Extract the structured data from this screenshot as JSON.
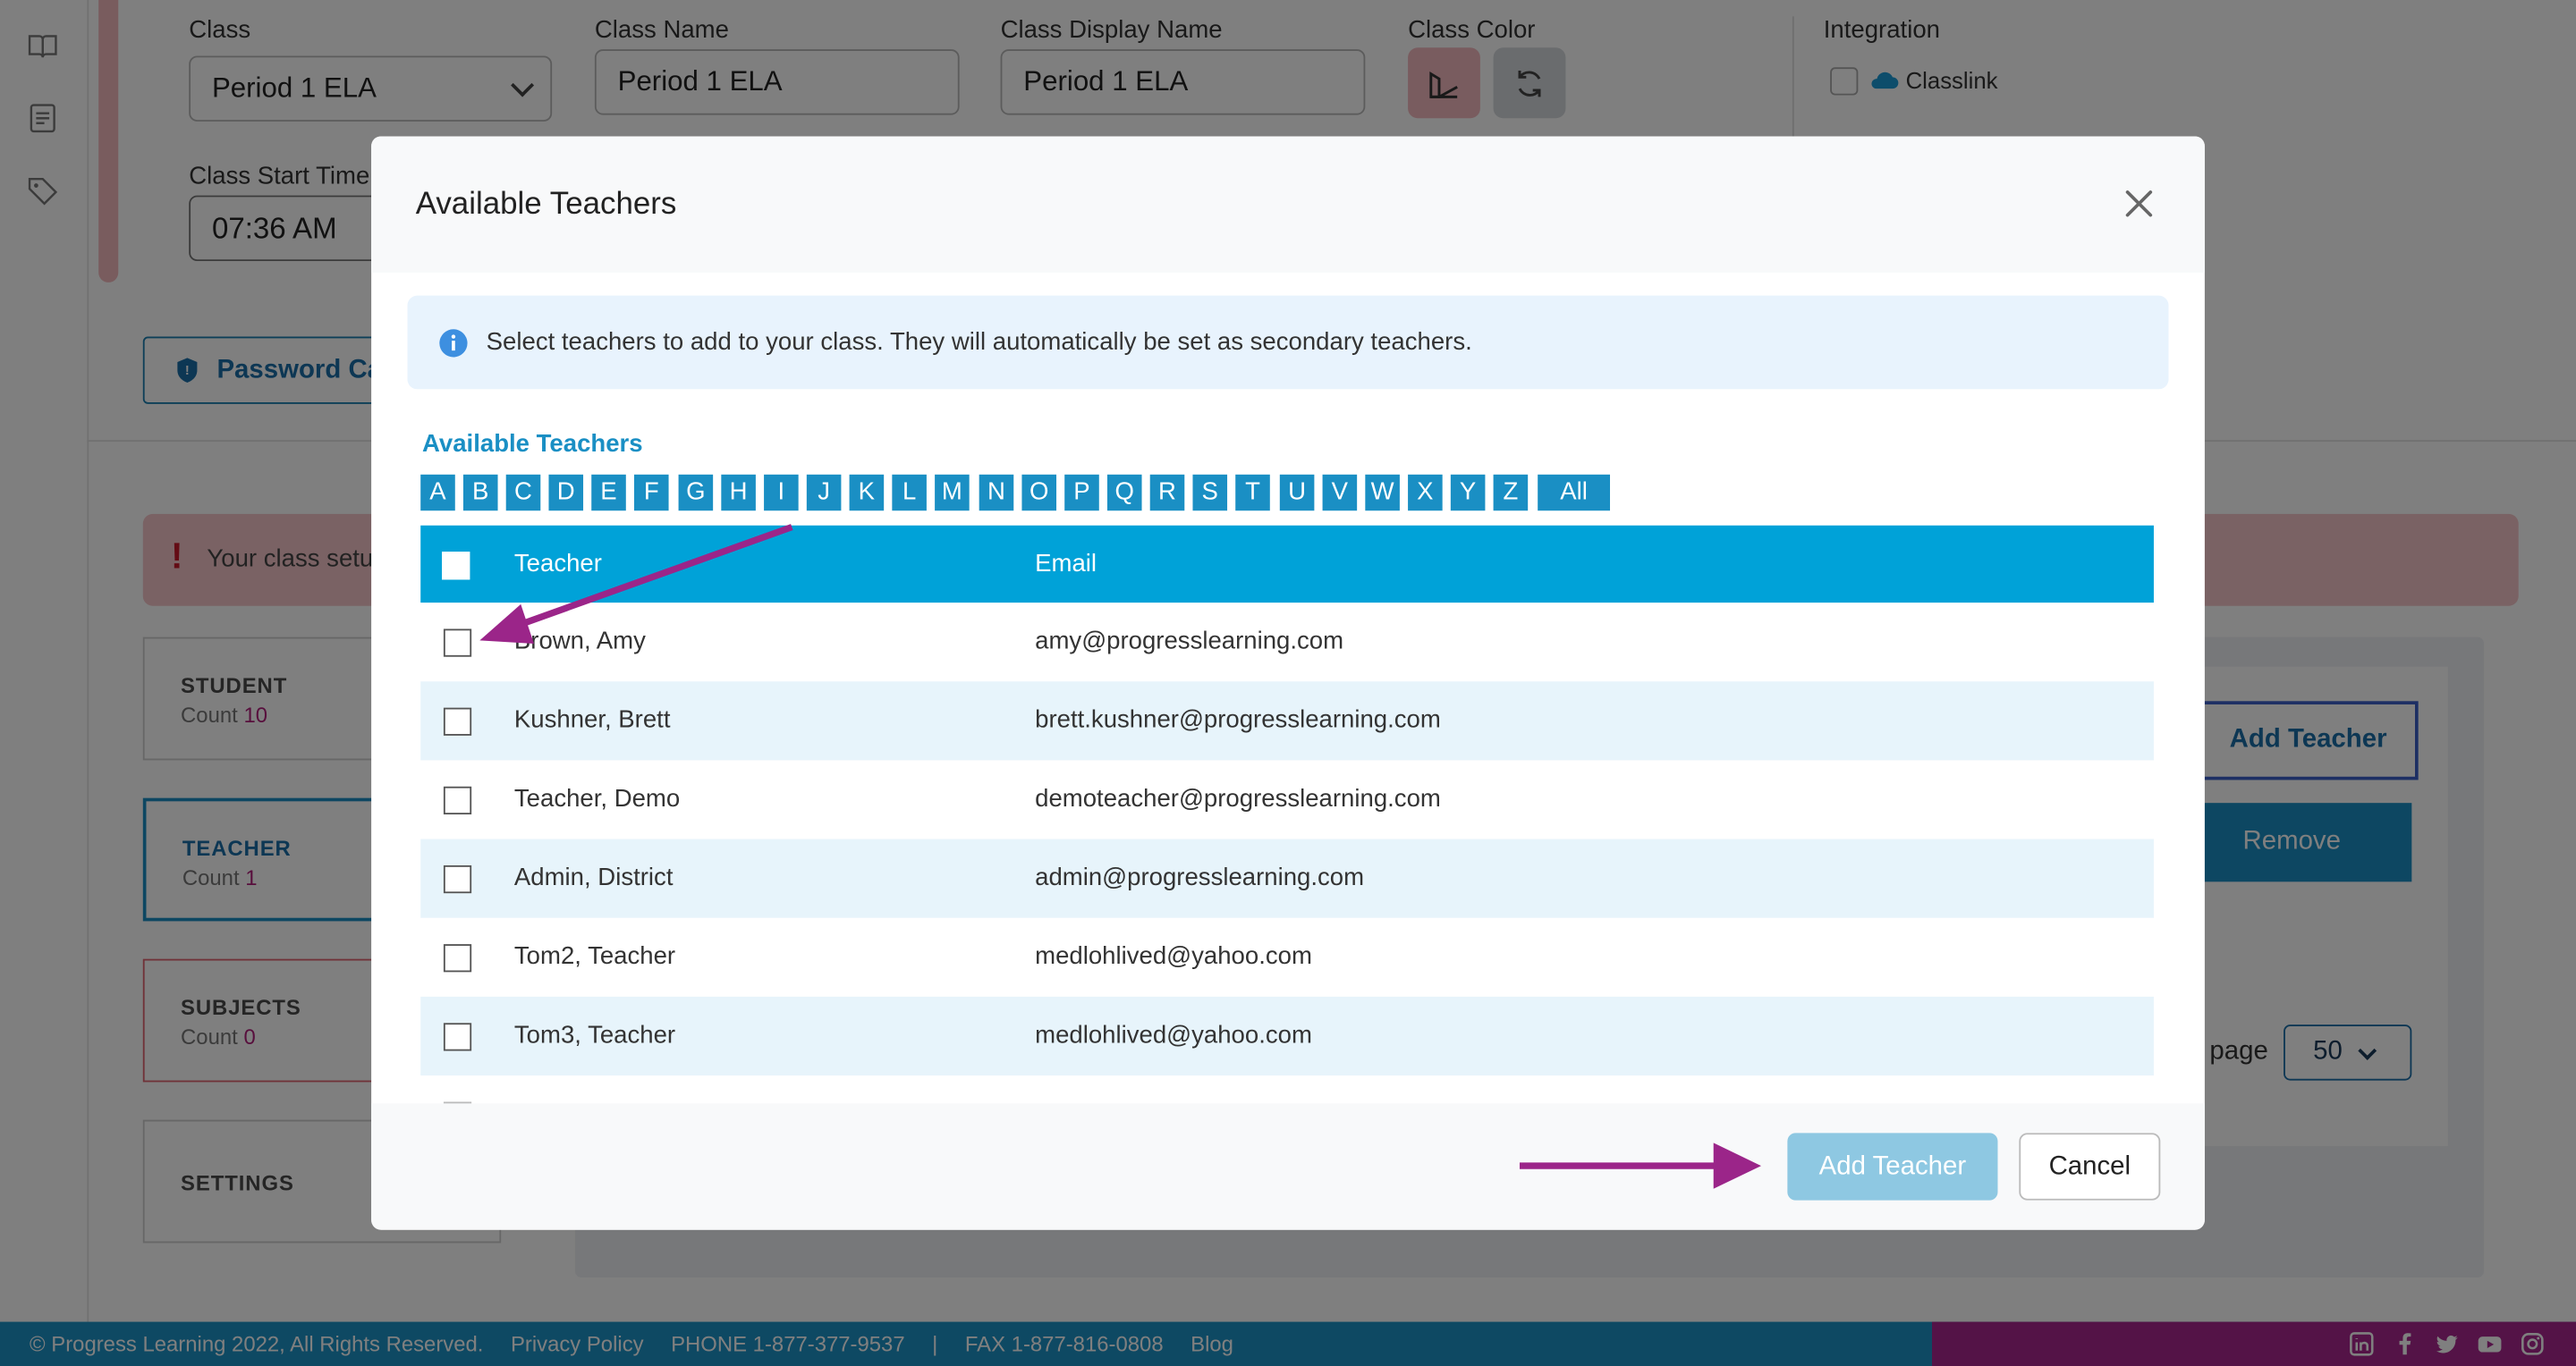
{
  "background": {
    "form": {
      "class_label": "Class",
      "class_value": "Period 1 ELA",
      "class_name_label": "Class Name",
      "class_name_value": "Period 1 ELA",
      "display_name_label": "Class Display Name",
      "display_name_value": "Period 1 ELA",
      "color_label": "Class Color",
      "start_time_label": "Class Start Time",
      "start_time_value": "07:36 AM",
      "integration_label": "Integration",
      "integration_option": "Classlink"
    },
    "password_button": "Password Ca",
    "alert_text": "Your class setu",
    "cards": [
      {
        "title": "STUDENT",
        "count_label": "Count",
        "count": "10"
      },
      {
        "title": "TEACHER",
        "count_label": "Count",
        "count": "1"
      },
      {
        "title": "SUBJECTS",
        "count_label": "Count",
        "count": "0"
      },
      {
        "title": "SETTINGS"
      }
    ],
    "add_teacher_button": "Add Teacher",
    "remove_button": "Remove",
    "per_page_label": "page",
    "per_page_value": "50"
  },
  "footer": {
    "copyright": "© Progress Learning 2022, All Rights Reserved.",
    "privacy": "Privacy Policy",
    "phone": "PHONE 1-877-377-9537",
    "separator": "|",
    "fax": "FAX 1-877-816-0808",
    "blog": "Blog",
    "social_icons": [
      "linkedin-icon",
      "facebook-icon",
      "twitter-icon",
      "youtube-icon",
      "instagram-icon"
    ]
  },
  "modal": {
    "title": "Available Teachers",
    "info_text": "Select teachers to add to your class. They will automatically be set as secondary teachers.",
    "section_title": "Available Teachers",
    "letters": [
      "A",
      "B",
      "C",
      "D",
      "E",
      "F",
      "G",
      "H",
      "I",
      "J",
      "K",
      "L",
      "M",
      "N",
      "O",
      "P",
      "Q",
      "R",
      "S",
      "T",
      "U",
      "V",
      "W",
      "X",
      "Y",
      "Z",
      "All"
    ],
    "table": {
      "headers": [
        "Teacher",
        "Email"
      ],
      "rows": [
        {
          "name": "Brown, Amy",
          "email": "amy@progresslearning.com"
        },
        {
          "name": "Kushner, Brett",
          "email": "brett.kushner@progresslearning.com"
        },
        {
          "name": "Teacher, Demo",
          "email": "demoteacher@progresslearning.com"
        },
        {
          "name": "Admin, District",
          "email": "admin@progresslearning.com"
        },
        {
          "name": "Tom2, Teacher",
          "email": "medlohlived@yahoo.com"
        },
        {
          "name": "Tom3, Teacher",
          "email": "medlohlived@yahoo.com"
        }
      ]
    },
    "add_button": "Add Teacher",
    "cancel_button": "Cancel"
  },
  "colors": {
    "accent": "#1a8fc4",
    "table_header": "#00a2d8",
    "annotation_arrow": "#9b2589",
    "footer_blue": "#1d93c7",
    "footer_purple": "#a8278f"
  }
}
